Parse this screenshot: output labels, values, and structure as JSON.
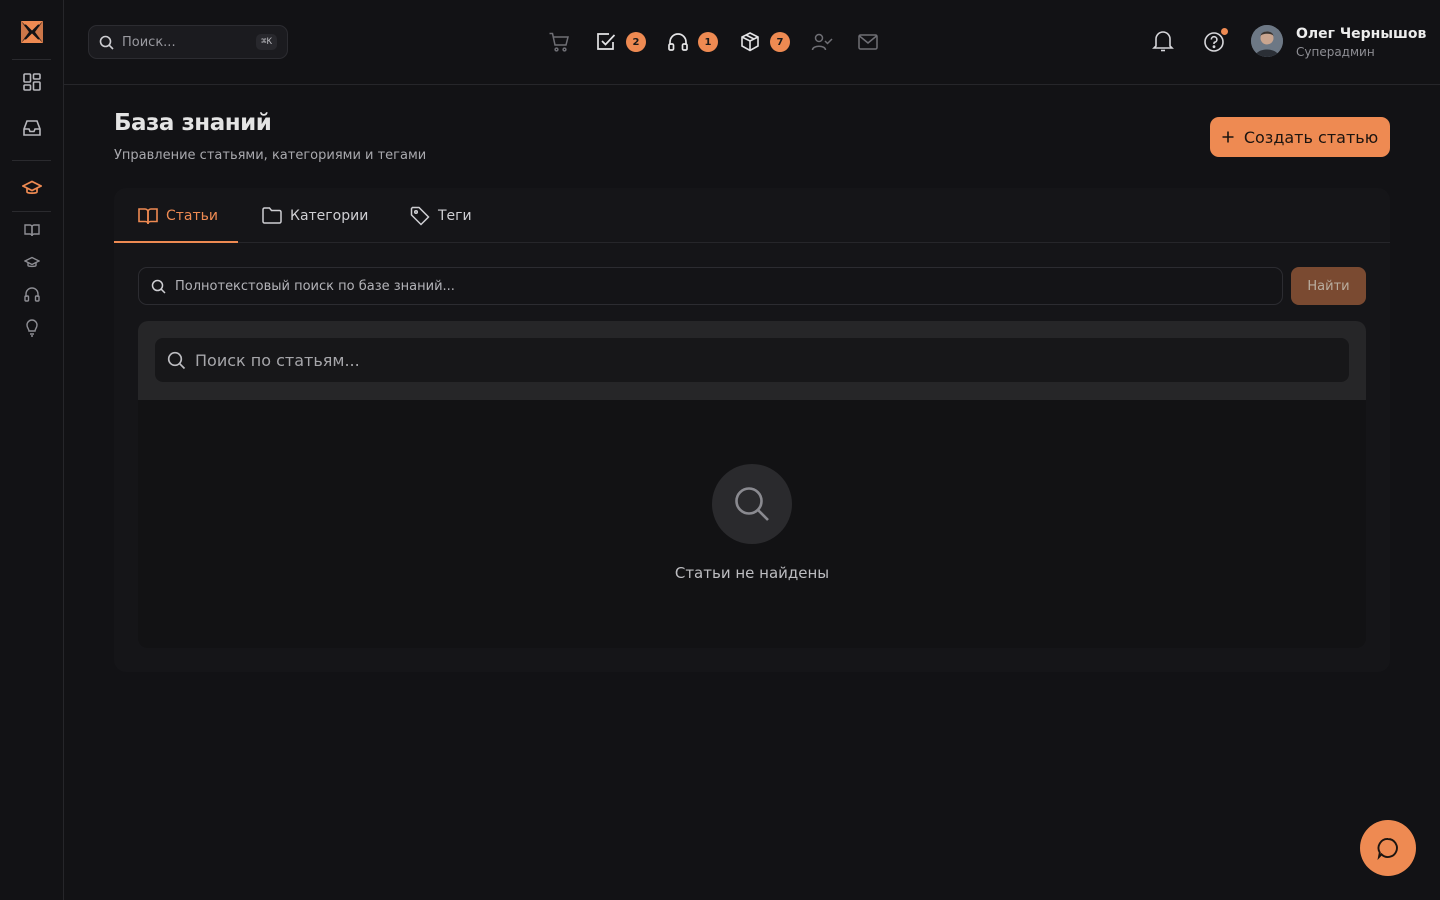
{
  "colors": {
    "accent": "#ee8a52",
    "background": "#121215",
    "panel": "#151518"
  },
  "sidebar": {
    "items": [
      {
        "icon": "dashboard-icon"
      },
      {
        "icon": "inbox-icon"
      },
      {
        "icon": "graduation-cap-icon",
        "active": true
      },
      {
        "icon": "book-icon"
      },
      {
        "icon": "graduation-cap-icon"
      },
      {
        "icon": "headphones-icon"
      },
      {
        "icon": "lightbulb-icon"
      }
    ]
  },
  "topbar": {
    "search": {
      "placeholder": "Поиск...",
      "shortcut": "⌘K"
    },
    "icons": [
      {
        "icon": "cart-icon",
        "badge": ""
      },
      {
        "icon": "check-square-icon",
        "badge": "2"
      },
      {
        "icon": "headphones-icon",
        "badge": "1"
      },
      {
        "icon": "package-icon",
        "badge": "7"
      },
      {
        "icon": "user-check-icon",
        "badge": ""
      },
      {
        "icon": "mail-icon",
        "badge": ""
      }
    ],
    "user": {
      "name": "Олег Чернышов",
      "role": "Суперадмин"
    }
  },
  "page": {
    "title": "База знаний",
    "subtitle": "Управление статьями, категориями и тегами",
    "create_label": "Создать статью",
    "tabs": [
      {
        "label": "Статьи",
        "icon": "book-open-icon",
        "active": true
      },
      {
        "label": "Категории",
        "icon": "folder-icon"
      },
      {
        "label": "Теги",
        "icon": "tag-icon"
      }
    ],
    "fulltext": {
      "placeholder": "Полнотекстовый поиск по базе знаний...",
      "button": "Найти"
    },
    "articles": {
      "placeholder": "Поиск по статьям...",
      "empty": "Статьи не найдены"
    }
  }
}
